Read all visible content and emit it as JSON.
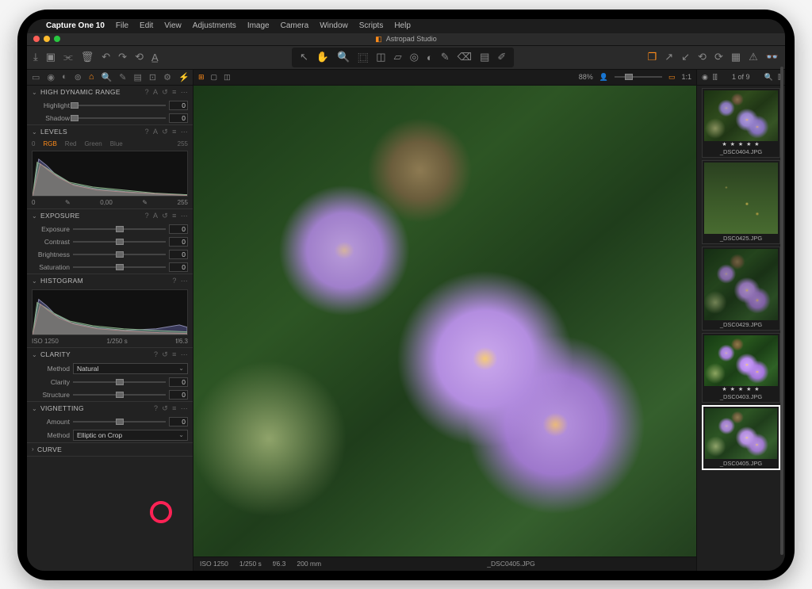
{
  "menu": {
    "apple": "",
    "app": "Capture One 10",
    "items": [
      "File",
      "Edit",
      "View",
      "Adjustments",
      "Image",
      "Camera",
      "Window",
      "Scripts",
      "Help"
    ]
  },
  "window": {
    "title": "Astropad Studio"
  },
  "viewer": {
    "zoom": "88%",
    "file": "_DSC0405.JPG",
    "iso": "ISO 1250",
    "shutter": "1/250 s",
    "aperture": "f/6.3",
    "focal": "200 mm"
  },
  "browser": {
    "counter": "1 of 9"
  },
  "sections": {
    "hdr": {
      "title": "HIGH DYNAMIC RANGE",
      "highlight_lbl": "Highlight",
      "highlight_val": "0",
      "shadow_lbl": "Shadow",
      "shadow_val": "0"
    },
    "levels": {
      "title": "LEVELS",
      "ch_rgb": "RGB",
      "ch_r": "Red",
      "ch_g": "Green",
      "ch_b": "Blue",
      "min": "0",
      "max": "255",
      "left": "0",
      "mid": "0,00",
      "right": "255"
    },
    "exposure": {
      "title": "EXPOSURE",
      "exp_lbl": "Exposure",
      "exp_val": "0",
      "con_lbl": "Contrast",
      "con_val": "0",
      "bri_lbl": "Brightness",
      "bri_val": "0",
      "sat_lbl": "Saturation",
      "sat_val": "0"
    },
    "histogram": {
      "title": "HISTOGRAM",
      "iso": "ISO 1250",
      "shutter": "1/250 s",
      "ap": "f/6.3"
    },
    "clarity": {
      "title": "CLARITY",
      "method_lbl": "Method",
      "method_val": "Natural",
      "clar_lbl": "Clarity",
      "clar_val": "0",
      "str_lbl": "Structure",
      "str_val": "0"
    },
    "vignette": {
      "title": "VIGNETTING",
      "amt_lbl": "Amount",
      "amt_val": "0",
      "method_lbl": "Method",
      "method_val": "Elliptic on Crop"
    },
    "curve": {
      "title": "CURVE"
    }
  },
  "thumbs": [
    {
      "file": "_DSC0404.JPG",
      "stars": "★ ★ ★ ★ ★"
    },
    {
      "file": "_DSC0425.JPG"
    },
    {
      "file": "_DSC0429.JPG"
    },
    {
      "file": "_DSC0403.JPG",
      "stars": "★ ★ ★ ★ ★"
    },
    {
      "file": "_DSC0405.JPG"
    }
  ]
}
